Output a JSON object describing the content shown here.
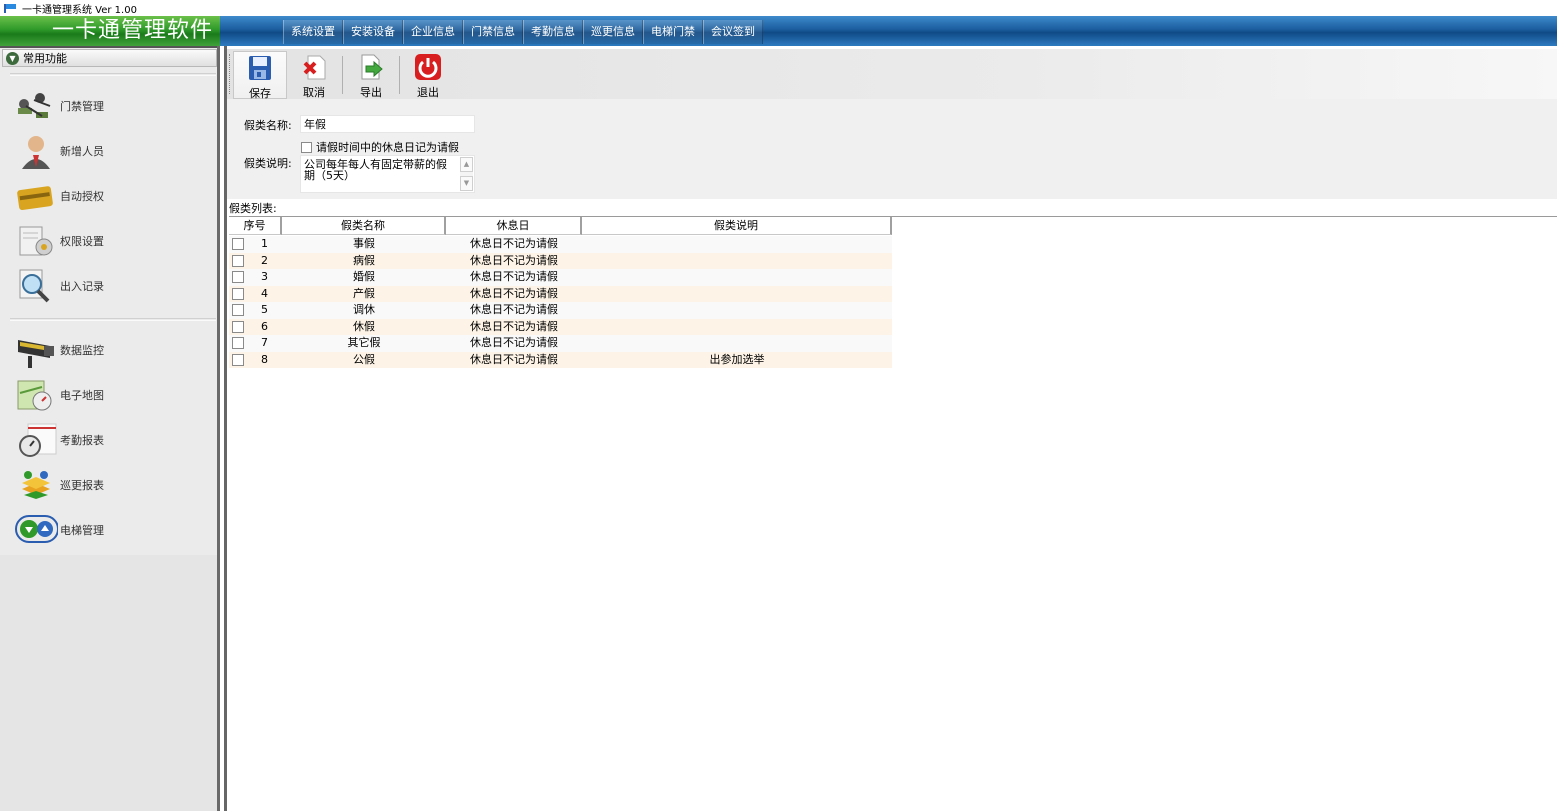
{
  "window": {
    "title": "一卡通管理系统  Ver 1.00"
  },
  "banner": {
    "brand": "一卡通管理软件",
    "menu": [
      "系统设置",
      "安装设备",
      "企业信息",
      "门禁信息",
      "考勤信息",
      "巡更信息",
      "电梯门禁",
      "会议签到"
    ]
  },
  "sidebar": {
    "header": "常用功能",
    "items": [
      {
        "label": "门禁管理",
        "icon": "door-access-icon"
      },
      {
        "label": "新增人员",
        "icon": "user-icon"
      },
      {
        "label": "自动授权",
        "icon": "card-icon"
      },
      {
        "label": "权限设置",
        "icon": "permission-icon"
      },
      {
        "label": "出入记录",
        "icon": "record-search-icon"
      },
      {
        "label": "数据监控",
        "icon": "camera-icon"
      },
      {
        "label": "电子地图",
        "icon": "map-icon"
      },
      {
        "label": "考勤报表",
        "icon": "stopwatch-icon"
      },
      {
        "label": "巡更报表",
        "icon": "patrol-icon"
      },
      {
        "label": "电梯管理",
        "icon": "elevator-icon"
      }
    ]
  },
  "toolbar": {
    "save": "保存",
    "cancel": "取消",
    "export": "导出",
    "exit": "退出"
  },
  "form": {
    "name_label": "假类名称:",
    "name_value": "年假",
    "rest_check_label": "请假时间中的休息日记为请假",
    "rest_checked": false,
    "desc_label": "假类说明:",
    "desc_value": "公司每年每人有固定带薪的假期（5天）"
  },
  "list": {
    "title": "假类列表:",
    "columns": [
      "序号",
      "假类名称",
      "休息日",
      "假类说明"
    ],
    "rows": [
      {
        "no": "1",
        "name": "事假",
        "rest": "休息日不记为请假",
        "desc": ""
      },
      {
        "no": "2",
        "name": "病假",
        "rest": "休息日不记为请假",
        "desc": ""
      },
      {
        "no": "3",
        "name": "婚假",
        "rest": "休息日不记为请假",
        "desc": ""
      },
      {
        "no": "4",
        "name": "产假",
        "rest": "休息日不记为请假",
        "desc": ""
      },
      {
        "no": "5",
        "name": "调休",
        "rest": "休息日不记为请假",
        "desc": ""
      },
      {
        "no": "6",
        "name": "休假",
        "rest": "休息日不记为请假",
        "desc": ""
      },
      {
        "no": "7",
        "name": "其它假",
        "rest": "休息日不记为请假",
        "desc": ""
      },
      {
        "no": "8",
        "name": "公假",
        "rest": "休息日不记为请假",
        "desc": "出参加选举"
      }
    ]
  },
  "colors": {
    "banner_blue": "#1b5d9e",
    "brand_green": "#2f9a2a",
    "row_alt": "#fdf3e6",
    "exit_red": "#d81e1e"
  }
}
